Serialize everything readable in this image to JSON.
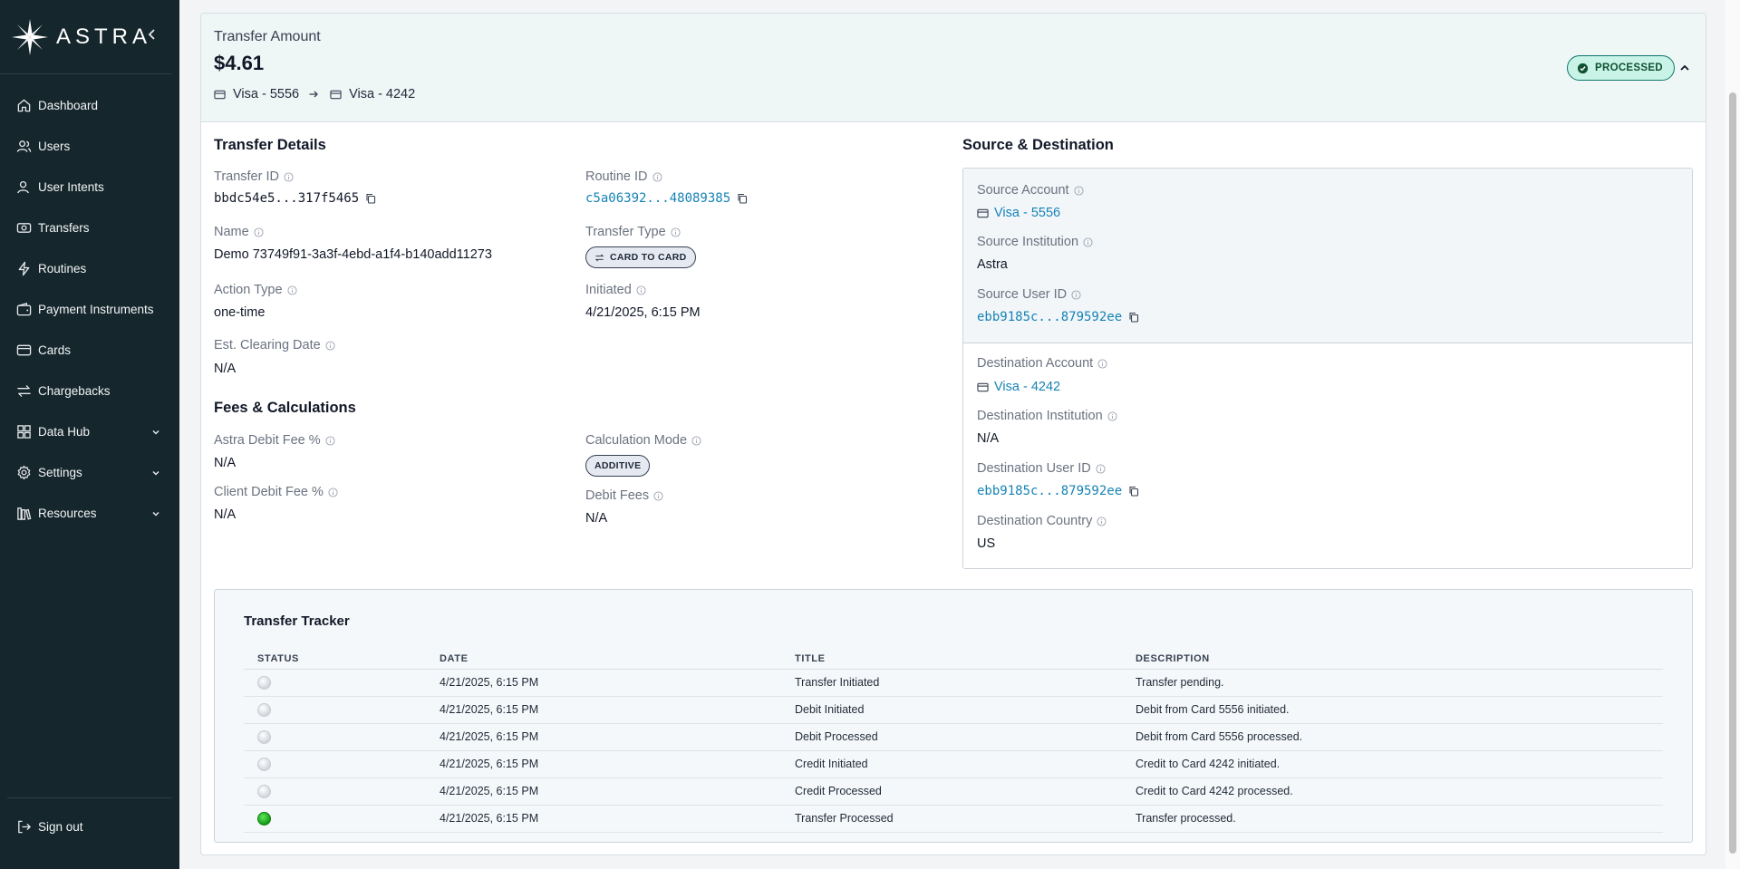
{
  "brand": {
    "name": "ASTRA"
  },
  "sidebar": {
    "items": [
      {
        "label": "Dashboard",
        "icon": "home-icon"
      },
      {
        "label": "Users",
        "icon": "users-icon"
      },
      {
        "label": "User Intents",
        "icon": "user-intent-icon"
      },
      {
        "label": "Transfers",
        "icon": "transfers-icon"
      },
      {
        "label": "Routines",
        "icon": "lightning-icon"
      },
      {
        "label": "Payment Instruments",
        "icon": "wallet-icon"
      },
      {
        "label": "Cards",
        "icon": "card-icon"
      },
      {
        "label": "Chargebacks",
        "icon": "swap-icon"
      },
      {
        "label": "Data Hub",
        "icon": "grid-icon",
        "expandable": true
      },
      {
        "label": "Settings",
        "icon": "gear-icon",
        "expandable": true
      },
      {
        "label": "Resources",
        "icon": "library-icon",
        "expandable": true
      }
    ],
    "signout": "Sign out"
  },
  "header": {
    "amount_label": "Transfer Amount",
    "amount": "$4.61",
    "source": "Visa - 5556",
    "destination": "Visa - 4242",
    "status": "PROCESSED",
    "status_color": "#c9f3e6"
  },
  "details": {
    "title": "Transfer Details",
    "transfer_id_label": "Transfer ID",
    "transfer_id": "bbdc54e5...317f5465",
    "routine_id_label": "Routine ID",
    "routine_id": "c5a06392...48089385",
    "name_label": "Name",
    "name": "Demo 73749f91-3a3f-4ebd-a1f4-b140add11273",
    "transfer_type_label": "Transfer Type",
    "transfer_type": "CARD TO CARD",
    "action_type_label": "Action Type",
    "action_type": "one-time",
    "initiated_label": "Initiated",
    "initiated": "4/21/2025, 6:15 PM",
    "clearing_label": "Est. Clearing Date",
    "clearing": "N/A"
  },
  "fees": {
    "title": "Fees & Calculations",
    "astra_fee_label": "Astra Debit Fee %",
    "astra_fee": "N/A",
    "calc_mode_label": "Calculation Mode",
    "calc_mode": "ADDITIVE",
    "client_fee_label": "Client Debit Fee %",
    "client_fee": "N/A",
    "debit_fees_label": "Debit Fees",
    "debit_fees": "N/A"
  },
  "source_dest": {
    "title": "Source & Destination",
    "source_account_label": "Source Account",
    "source_account": "Visa - 5556",
    "source_institution_label": "Source Institution",
    "source_institution": "Astra",
    "source_user_label": "Source User ID",
    "source_user": "ebb9185c...879592ee",
    "dest_account_label": "Destination Account",
    "dest_account": "Visa - 4242",
    "dest_institution_label": "Destination Institution",
    "dest_institution": "N/A",
    "dest_user_label": "Destination User ID",
    "dest_user": "ebb9185c...879592ee",
    "dest_country_label": "Destination Country",
    "dest_country": "US"
  },
  "tracker": {
    "title": "Transfer Tracker",
    "columns": [
      "STATUS",
      "DATE",
      "TITLE",
      "DESCRIPTION"
    ],
    "rows": [
      {
        "status": "pending",
        "date": "4/21/2025, 6:15 PM",
        "title": "Transfer Initiated",
        "description": "Transfer pending."
      },
      {
        "status": "pending",
        "date": "4/21/2025, 6:15 PM",
        "title": "Debit Initiated",
        "description": "Debit from Card 5556 initiated."
      },
      {
        "status": "pending",
        "date": "4/21/2025, 6:15 PM",
        "title": "Debit Processed",
        "description": "Debit from Card 5556 processed."
      },
      {
        "status": "pending",
        "date": "4/21/2025, 6:15 PM",
        "title": "Credit Initiated",
        "description": "Credit to Card 4242 initiated."
      },
      {
        "status": "pending",
        "date": "4/21/2025, 6:15 PM",
        "title": "Credit Processed",
        "description": "Credit to Card 4242 processed."
      },
      {
        "status": "done",
        "date": "4/21/2025, 6:15 PM",
        "title": "Transfer Processed",
        "description": "Transfer processed."
      }
    ]
  }
}
